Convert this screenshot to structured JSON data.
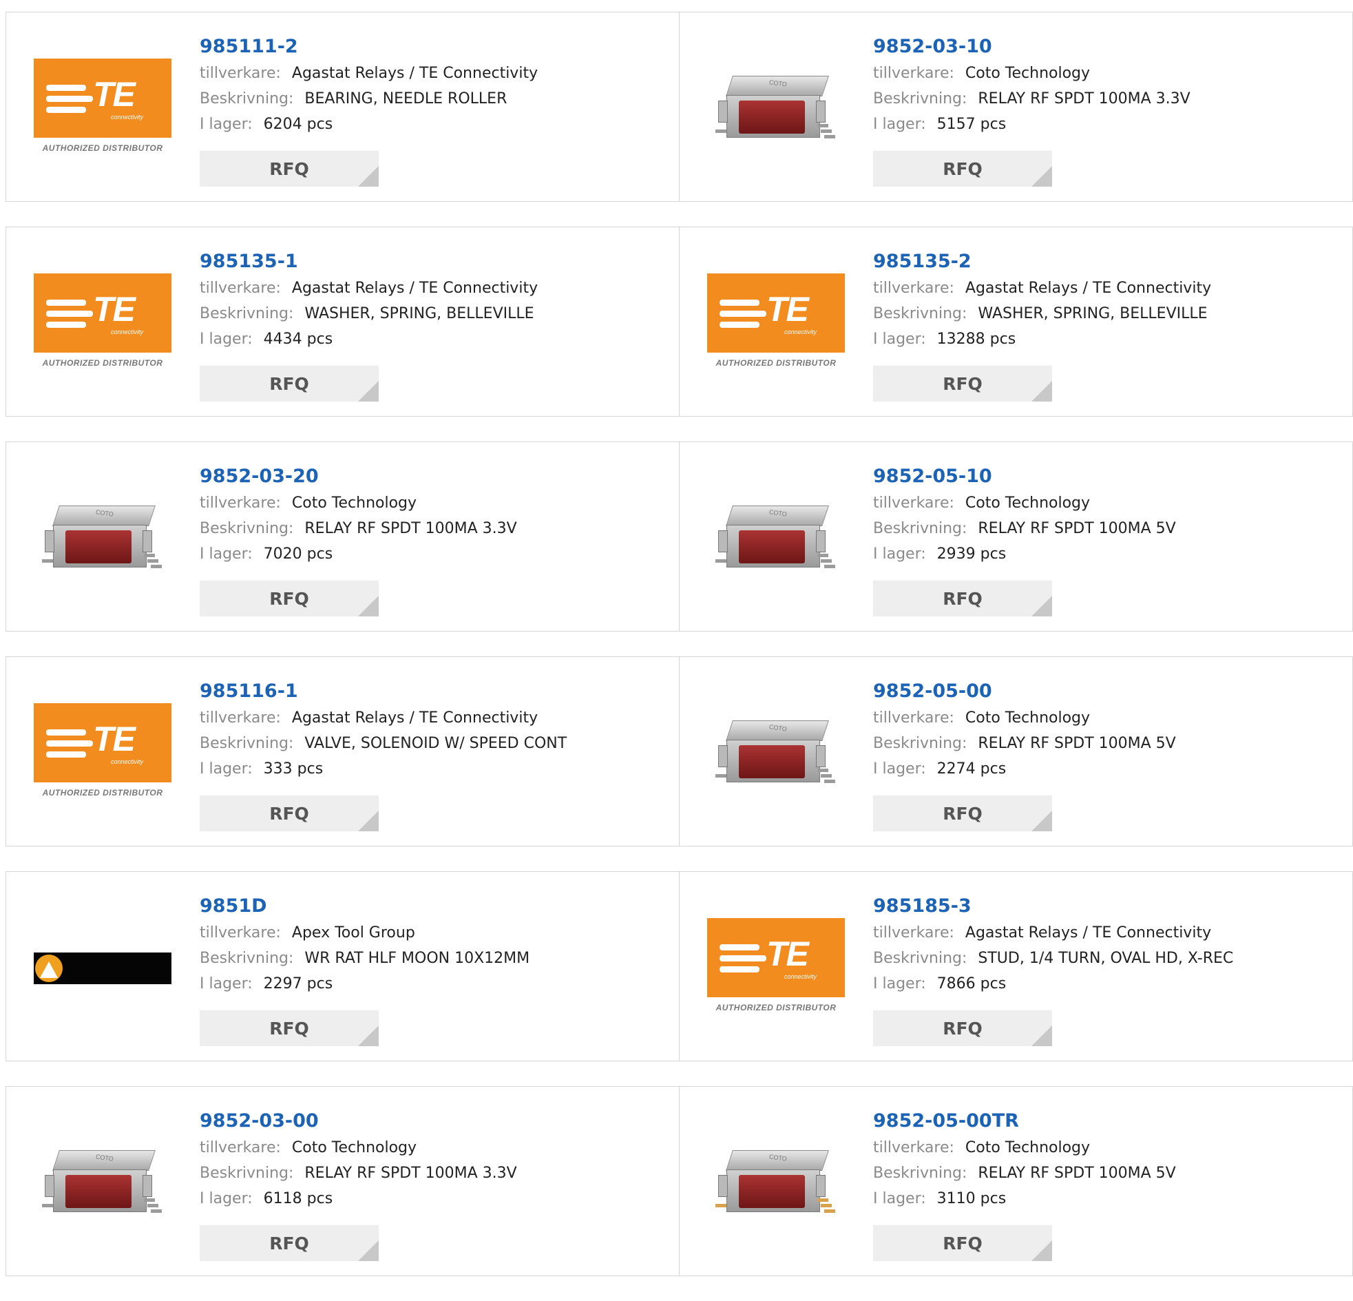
{
  "labels": {
    "manufacturer": "tillverkare:",
    "description": "Beskrivning:",
    "stock": "I lager:",
    "rfq": "RFQ"
  },
  "logos": {
    "te_text": "TE",
    "te_sub": "connectivity",
    "te_distributor": "AUTHORIZED DISTRIBUTOR",
    "relay_mark": "COTO"
  },
  "colors": {
    "part_link": "#1c63b5",
    "te_orange": "#f28c1e",
    "rfq_bg": "#eeeeee"
  },
  "products": [
    {
      "part": "985111-2",
      "manufacturer": "Agastat Relays / TE Connectivity",
      "description": "BEARING, NEEDLE ROLLER",
      "stock": "6204 pcs",
      "image": "te-logo"
    },
    {
      "part": "9852-03-10",
      "manufacturer": "Coto Technology",
      "description": "RELAY RF SPDT 100MA 3.3V",
      "stock": "5157 pcs",
      "image": "relay-straight"
    },
    {
      "part": "985135-1",
      "manufacturer": "Agastat Relays / TE Connectivity",
      "description": "WASHER, SPRING, BELLEVILLE",
      "stock": "4434 pcs",
      "image": "te-logo"
    },
    {
      "part": "985135-2",
      "manufacturer": "Agastat Relays / TE Connectivity",
      "description": "WASHER, SPRING, BELLEVILLE",
      "stock": "13288 pcs",
      "image": "te-logo"
    },
    {
      "part": "9852-03-20",
      "manufacturer": "Coto Technology",
      "description": "RELAY RF SPDT 100MA 3.3V",
      "stock": "7020 pcs",
      "image": "relay-gullwing"
    },
    {
      "part": "9852-05-10",
      "manufacturer": "Coto Technology",
      "description": "RELAY RF SPDT 100MA 5V",
      "stock": "2939 pcs",
      "image": "relay-straight"
    },
    {
      "part": "985116-1",
      "manufacturer": "Agastat Relays / TE Connectivity",
      "description": "VALVE, SOLENOID W/ SPEED CONT",
      "stock": "333 pcs",
      "image": "te-logo"
    },
    {
      "part": "9852-05-00",
      "manufacturer": "Coto Technology",
      "description": "RELAY RF SPDT 100MA 5V",
      "stock": "2274 pcs",
      "image": "relay-gullwing"
    },
    {
      "part": "9851D",
      "manufacturer": "Apex Tool Group",
      "description": "WR RAT HLF MOON 10X12MM",
      "stock": "2297 pcs",
      "image": "apex-logo"
    },
    {
      "part": "985185-3",
      "manufacturer": "Agastat Relays / TE Connectivity",
      "description": "STUD, 1/4 TURN, OVAL HD, X-REC",
      "stock": "7866 pcs",
      "image": "te-logo"
    },
    {
      "part": "9852-03-00",
      "manufacturer": "Coto Technology",
      "description": "RELAY RF SPDT 100MA 3.3V",
      "stock": "6118 pcs",
      "image": "relay-gullwing"
    },
    {
      "part": "9852-05-00TR",
      "manufacturer": "Coto Technology",
      "description": "RELAY RF SPDT 100MA 5V",
      "stock": "3110 pcs",
      "image": "relay-gold"
    }
  ]
}
